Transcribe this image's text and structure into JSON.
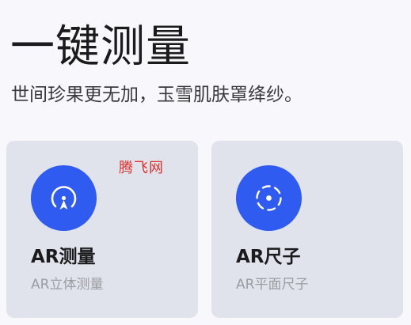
{
  "header": {
    "title": "一键测量",
    "subtitle": "世间珍果更无加，玉雪肌肤罩绛纱。"
  },
  "cards": [
    {
      "title": "AR测量",
      "subtitle": "AR立体测量",
      "icon": "ar-measure-icon"
    },
    {
      "title": "AR尺子",
      "subtitle": "AR平面尺子",
      "icon": "ar-ruler-icon"
    }
  ],
  "watermark": {
    "text": "腾飞网"
  },
  "colors": {
    "accent": "#2f5bf0",
    "card_bg": "#e1e3ec",
    "watermark": "#e0302a"
  }
}
